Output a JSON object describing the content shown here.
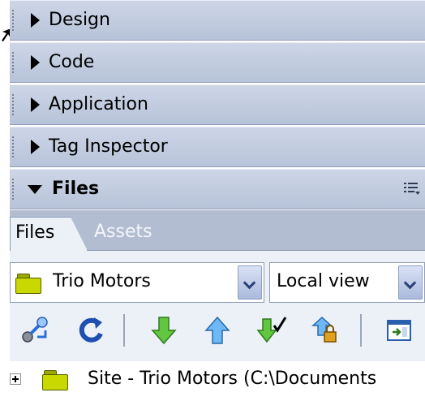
{
  "panels": [
    {
      "label": "Design",
      "expanded": false
    },
    {
      "label": "Code",
      "expanded": false
    },
    {
      "label": "Application",
      "expanded": false
    },
    {
      "label": "Tag Inspector",
      "expanded": false
    },
    {
      "label": "Files",
      "expanded": true
    }
  ],
  "tabs": {
    "files": "Files",
    "assets": "Assets"
  },
  "site_select": {
    "value": "Trio Motors"
  },
  "view_select": {
    "value": "Local view"
  },
  "toolbar_icons": [
    "connect-icon",
    "refresh-icon",
    "get-files-icon",
    "put-files-icon",
    "check-out-icon",
    "check-in-icon",
    "expand-icon"
  ],
  "tree": {
    "root_label": "Site - Trio Motors (C:\\Documents"
  },
  "colors": {
    "panel_header": "#c4cde0",
    "tab_strip": "#b2bdd2",
    "toolbar_bg": "#ecf0f7",
    "folder": "#c8d800",
    "arrow_green": "#5cc43c",
    "arrow_blue": "#5aa8f0"
  }
}
